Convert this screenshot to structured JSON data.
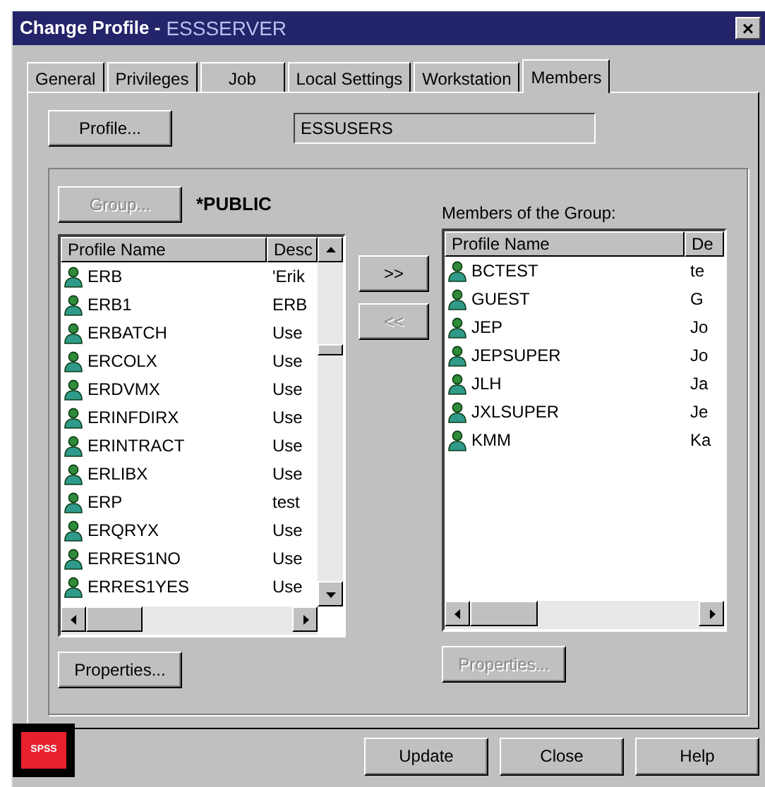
{
  "window": {
    "title": "Change Profile -",
    "subtitle": "ESSSERVER",
    "close": "×"
  },
  "tabs": [
    {
      "label": "General",
      "selected": false
    },
    {
      "label": "Privileges",
      "selected": false
    },
    {
      "label": "Job",
      "selected": false
    },
    {
      "label": "Local Settings",
      "selected": false
    },
    {
      "label": "Workstation",
      "selected": false
    },
    {
      "label": "Members",
      "selected": true
    }
  ],
  "profile": {
    "button": "Profile...",
    "value": "ESSUSERS"
  },
  "group": {
    "button": "Group...",
    "disabled": true,
    "name": "*PUBLIC"
  },
  "left_list": {
    "columns": [
      "Profile Name",
      "Desc"
    ],
    "rows": [
      {
        "name": "ERB",
        "desc": "'Erik"
      },
      {
        "name": "ERB1",
        "desc": "ERB"
      },
      {
        "name": "ERBATCH",
        "desc": "Use"
      },
      {
        "name": "ERCOLX",
        "desc": "Use"
      },
      {
        "name": "ERDVMX",
        "desc": "Use"
      },
      {
        "name": "ERINFDIRX",
        "desc": "Use"
      },
      {
        "name": "ERINTRACT",
        "desc": "Use"
      },
      {
        "name": "ERLIBX",
        "desc": "Use"
      },
      {
        "name": "ERP",
        "desc": "test"
      },
      {
        "name": "ERQRYX",
        "desc": "Use"
      },
      {
        "name": "ERRES1NO",
        "desc": "Use"
      },
      {
        "name": "ERRES1YES",
        "desc": "Use"
      }
    ],
    "properties": {
      "label": "Properties...",
      "disabled": false
    }
  },
  "move_buttons": [
    {
      "label": ">>",
      "disabled": false
    },
    {
      "label": "<<",
      "disabled": true
    }
  ],
  "right_list": {
    "label": "Members of the Group:",
    "columns": [
      "Profile Name",
      "De"
    ],
    "rows": [
      {
        "name": "BCTEST",
        "desc": "te"
      },
      {
        "name": "GUEST",
        "desc": "G"
      },
      {
        "name": "JEP",
        "desc": "Jo"
      },
      {
        "name": "JEPSUPER",
        "desc": "Jo"
      },
      {
        "name": "JLH",
        "desc": "Ja"
      },
      {
        "name": "JXLSUPER",
        "desc": "Je"
      },
      {
        "name": "KMM",
        "desc": "Ka"
      }
    ],
    "properties": {
      "label": "Properties...",
      "disabled": true
    }
  },
  "logo": "SPSS",
  "buttons": [
    "Update",
    "Close",
    "Help"
  ]
}
